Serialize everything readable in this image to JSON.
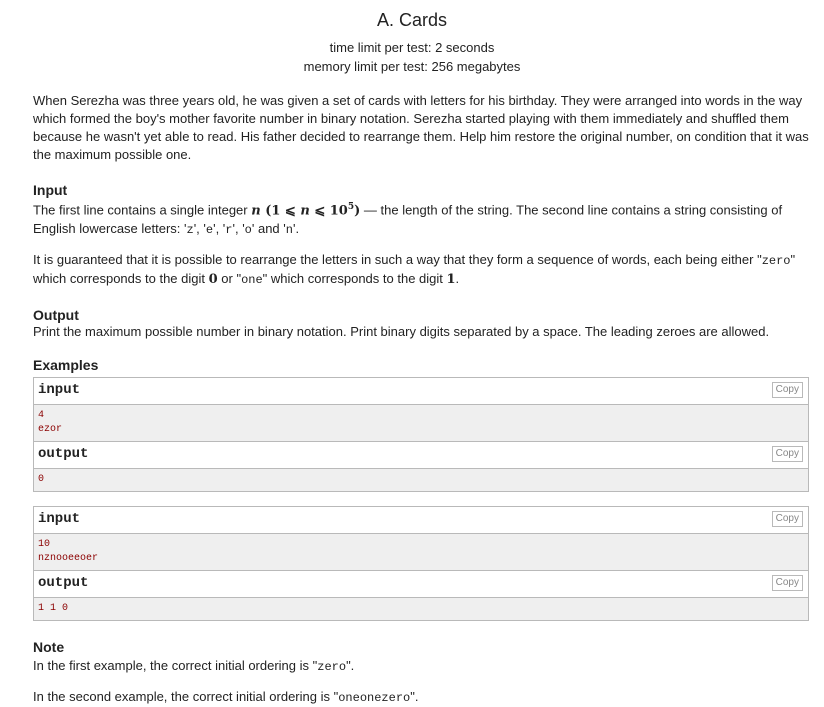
{
  "problem": {
    "title": "A. Cards",
    "time_limit": "time limit per test: 2 seconds",
    "memory_limit": "memory limit per test: 256 megabytes"
  },
  "legend": "When Serezha was three years old, he was given a set of cards with letters for his birthday. They were arranged into words in the way which formed the boy's mother favorite number in binary notation. Serezha started playing with them immediately and shuffled them because he wasn't yet able to read. His father decided to rearrange them. Help him restore the original number, on condition that it was the maximum possible one.",
  "input_section": {
    "title": "Input",
    "p1_a": "The first line contains a single integer ",
    "p1_math_n": "n",
    "p1_math_range_open": " (1 ⩽ ",
    "p1_math_range_n": "n",
    "p1_math_range_le": " ⩽ 10",
    "p1_math_exp": "5",
    "p1_math_close": ")",
    "p1_b": " — the length of the string. The second line contains a string consisting of English lowercase letters: '",
    "l_z": "z",
    "sep1": "', '",
    "l_e": "e",
    "sep2": "', '",
    "l_r": "r",
    "sep3": "', '",
    "l_o": "o",
    "sep4": "' and '",
    "l_n": "n",
    "p1_end": "'.",
    "p2_a": "It is guaranteed that it is possible to rearrange the letters in such a way that they form a sequence of words, each being either \"",
    "w_zero": "zero",
    "p2_b": "\" which corresponds to the digit ",
    "d0": "0",
    "p2_c": " or \"",
    "w_one": "one",
    "p2_d": "\" which corresponds to the digit ",
    "d1": "1",
    "p2_e": "."
  },
  "output_section": {
    "title": "Output",
    "text": "Print the maximum possible number in binary notation. Print binary digits separated by a space. The leading zeroes are allowed."
  },
  "examples": {
    "title": "Examples",
    "input_label": "input",
    "output_label": "output",
    "copy_label": "Copy",
    "items": [
      {
        "input": [
          "4",
          "ezor"
        ],
        "output": [
          "0"
        ]
      },
      {
        "input": [
          "10",
          "nznooeeoer"
        ],
        "output": [
          "1 1 0"
        ]
      }
    ]
  },
  "note": {
    "title": "Note",
    "p1_a": "In the first example, the correct initial ordering is \"",
    "p1_code": "zero",
    "p1_b": "\".",
    "p2_a": "In the second example, the correct initial ordering is \"",
    "p2_code": "oneonezero",
    "p2_b": "\"."
  }
}
